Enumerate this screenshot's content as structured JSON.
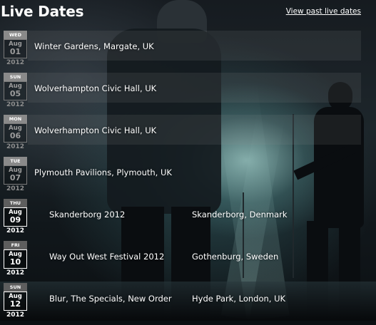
{
  "header": {
    "title": "Live Dates",
    "past_link_label": "View past live dates"
  },
  "gigs": [
    {
      "weekday": "WED",
      "month": "Aug",
      "day": "01",
      "year": "2012",
      "venue": "Winter Gardens, Margate, UK"
    },
    {
      "weekday": "SUN",
      "month": "Aug",
      "day": "05",
      "year": "2012",
      "venue": "Wolverhampton Civic Hall, UK"
    },
    {
      "weekday": "MON",
      "month": "Aug",
      "day": "06",
      "year": "2012",
      "venue": "Wolverhampton Civic Hall, UK"
    },
    {
      "weekday": "TUE",
      "month": "Aug",
      "day": "07",
      "year": "2012",
      "venue": "Plymouth Pavilions, Plymouth, UK"
    },
    {
      "weekday": "THU",
      "month": "Aug",
      "day": "09",
      "year": "2012",
      "event": "Skanderborg 2012",
      "location": "Skanderborg, Denmark"
    },
    {
      "weekday": "FRI",
      "month": "Aug",
      "day": "10",
      "year": "2012",
      "event": "Way Out West Festival 2012",
      "location": "Gothenburg, Sweden"
    },
    {
      "weekday": "SUN",
      "month": "Aug",
      "day": "12",
      "year": "2012",
      "event": "Blur, The Specials, New Order",
      "location": "Hyde Park, London, UK"
    }
  ],
  "colors": {
    "text": "#ffffff",
    "date_muted": "#9c9c9c",
    "weekday_bar": "#8a8a8a",
    "row_band": "rgba(150,150,150,0.13)"
  },
  "background_image": "concert-stage-photo"
}
